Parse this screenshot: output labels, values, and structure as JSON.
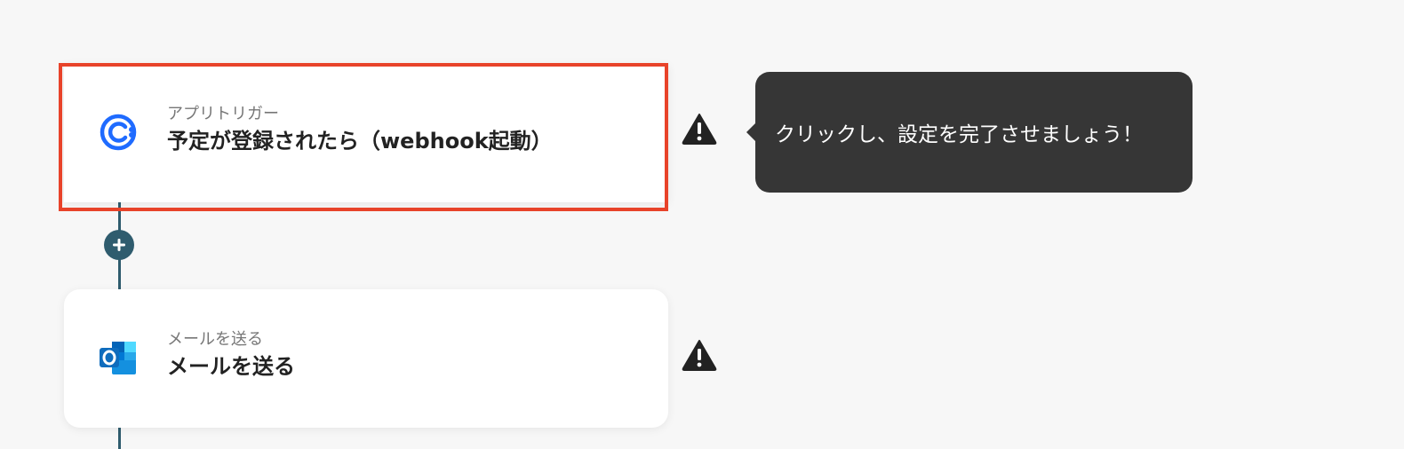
{
  "flow": {
    "steps": [
      {
        "type_label": "アプリトリガー",
        "title": "予定が登録されたら（webhook起動）",
        "icon": "calendly-icon",
        "highlighted": true,
        "warning": true
      },
      {
        "type_label": "メールを送る",
        "title": "メールを送る",
        "icon": "outlook-icon",
        "highlighted": false,
        "warning": true
      }
    ],
    "add_step_icon": "plus-icon"
  },
  "tooltip": {
    "text": "クリックし、設定を完了させましょう！"
  },
  "colors": {
    "background": "#f7f7f7",
    "connector": "#2f5c6e",
    "highlight": "#e8432a",
    "tooltip_bg": "#363636",
    "calendly_blue": "#1f6bff",
    "outlook_blue": "#0f6cbd"
  }
}
